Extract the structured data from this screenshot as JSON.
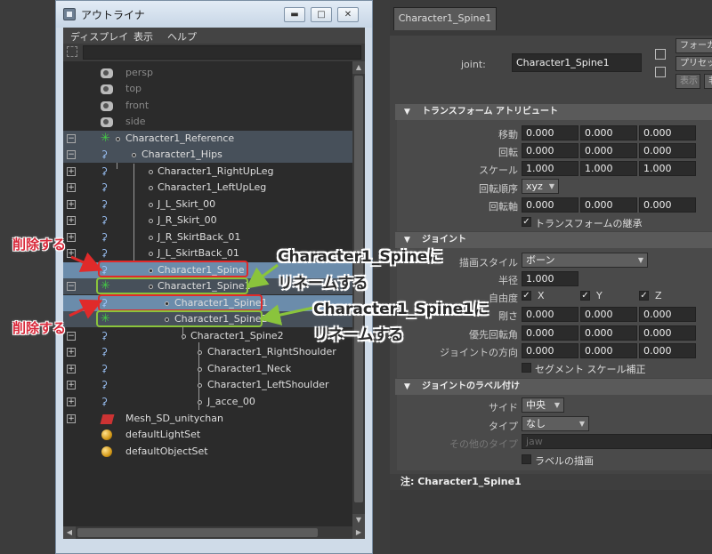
{
  "outliner": {
    "title": "アウトライナ",
    "menu": [
      "ディスプレイ",
      "表示",
      "ヘルプ"
    ],
    "nodes": [
      {
        "label": "persp"
      },
      {
        "label": "top"
      },
      {
        "label": "front"
      },
      {
        "label": "side"
      },
      {
        "label": "Character1_Reference"
      },
      {
        "label": "Character1_Hips"
      },
      {
        "label": "Character1_RightUpLeg"
      },
      {
        "label": "Character1_LeftUpLeg"
      },
      {
        "label": "J_L_Skirt_00"
      },
      {
        "label": "J_R_Skirt_00"
      },
      {
        "label": "J_R_SkirtBack_01"
      },
      {
        "label": "J_L_SkirtBack_01"
      },
      {
        "label": "Character1_Spine"
      },
      {
        "label": "Character1_Spine1"
      },
      {
        "label": "Character1_Spine1"
      },
      {
        "label": "Character1_Spine2"
      },
      {
        "label": "Character1_Spine2"
      },
      {
        "label": "Character1_RightShoulder"
      },
      {
        "label": "Character1_Neck"
      },
      {
        "label": "Character1_LeftShoulder"
      },
      {
        "label": "J_acce_00"
      },
      {
        "label": "Mesh_SD_unitychan"
      },
      {
        "label": "defaultLightSet"
      },
      {
        "label": "defaultObjectSet"
      }
    ]
  },
  "annotations": {
    "delete1": "削除する",
    "delete2": "削除する",
    "rename1_line1": "Character1_Spineに",
    "rename1_line2": "リネームする",
    "rename2_line1": "Character1_Spine1に",
    "rename2_line2": "リネームする"
  },
  "attr": {
    "tab": "Character1_Spine1",
    "joint_label": "joint:",
    "joint_value": "Character1_Spine1",
    "side_buttons": [
      "フォーカス",
      "プリセット",
      "表示",
      "非"
    ],
    "transform": {
      "title": "トランスフォーム アトリビュート",
      "translate_label": "移動",
      "translate": [
        "0.000",
        "0.000",
        "0.000"
      ],
      "rotate_label": "回転",
      "rotate": [
        "0.000",
        "0.000",
        "0.000"
      ],
      "scale_label": "スケール",
      "scale": [
        "1.000",
        "1.000",
        "1.000"
      ],
      "rotate_order_label": "回転順序",
      "rotate_order": "xyz",
      "rotate_axis_label": "回転軸",
      "rotate_axis": [
        "0.000",
        "0.000",
        "0.000"
      ],
      "inherit_label": "トランスフォームの継承"
    },
    "joint": {
      "title": "ジョイント",
      "draw_style_label": "描画スタイル",
      "draw_style": "ボーン",
      "radius_label": "半径",
      "radius": "1.000",
      "dof_label": "自由度",
      "dof": [
        "X",
        "Y",
        "Z"
      ],
      "stiffness_label": "剛さ",
      "stiffness": [
        "0.000",
        "0.000",
        "0.000"
      ],
      "pref_angle_label": "優先回転角",
      "pref_angle": [
        "0.000",
        "0.000",
        "0.000"
      ],
      "orient_label": "ジョイントの方向",
      "orient": [
        "0.000",
        "0.000",
        "0.000"
      ],
      "segment_label": "セグメント スケール補正"
    },
    "labelling": {
      "title": "ジョイントのラベル付け",
      "side_label": "サイド",
      "side": "中央",
      "type_label": "タイプ",
      "type": "なし",
      "other_label": "その他のタイプ",
      "other": "jaw",
      "draw_label": "ラベルの描画"
    },
    "notes": "注: Character1_Spine1"
  }
}
